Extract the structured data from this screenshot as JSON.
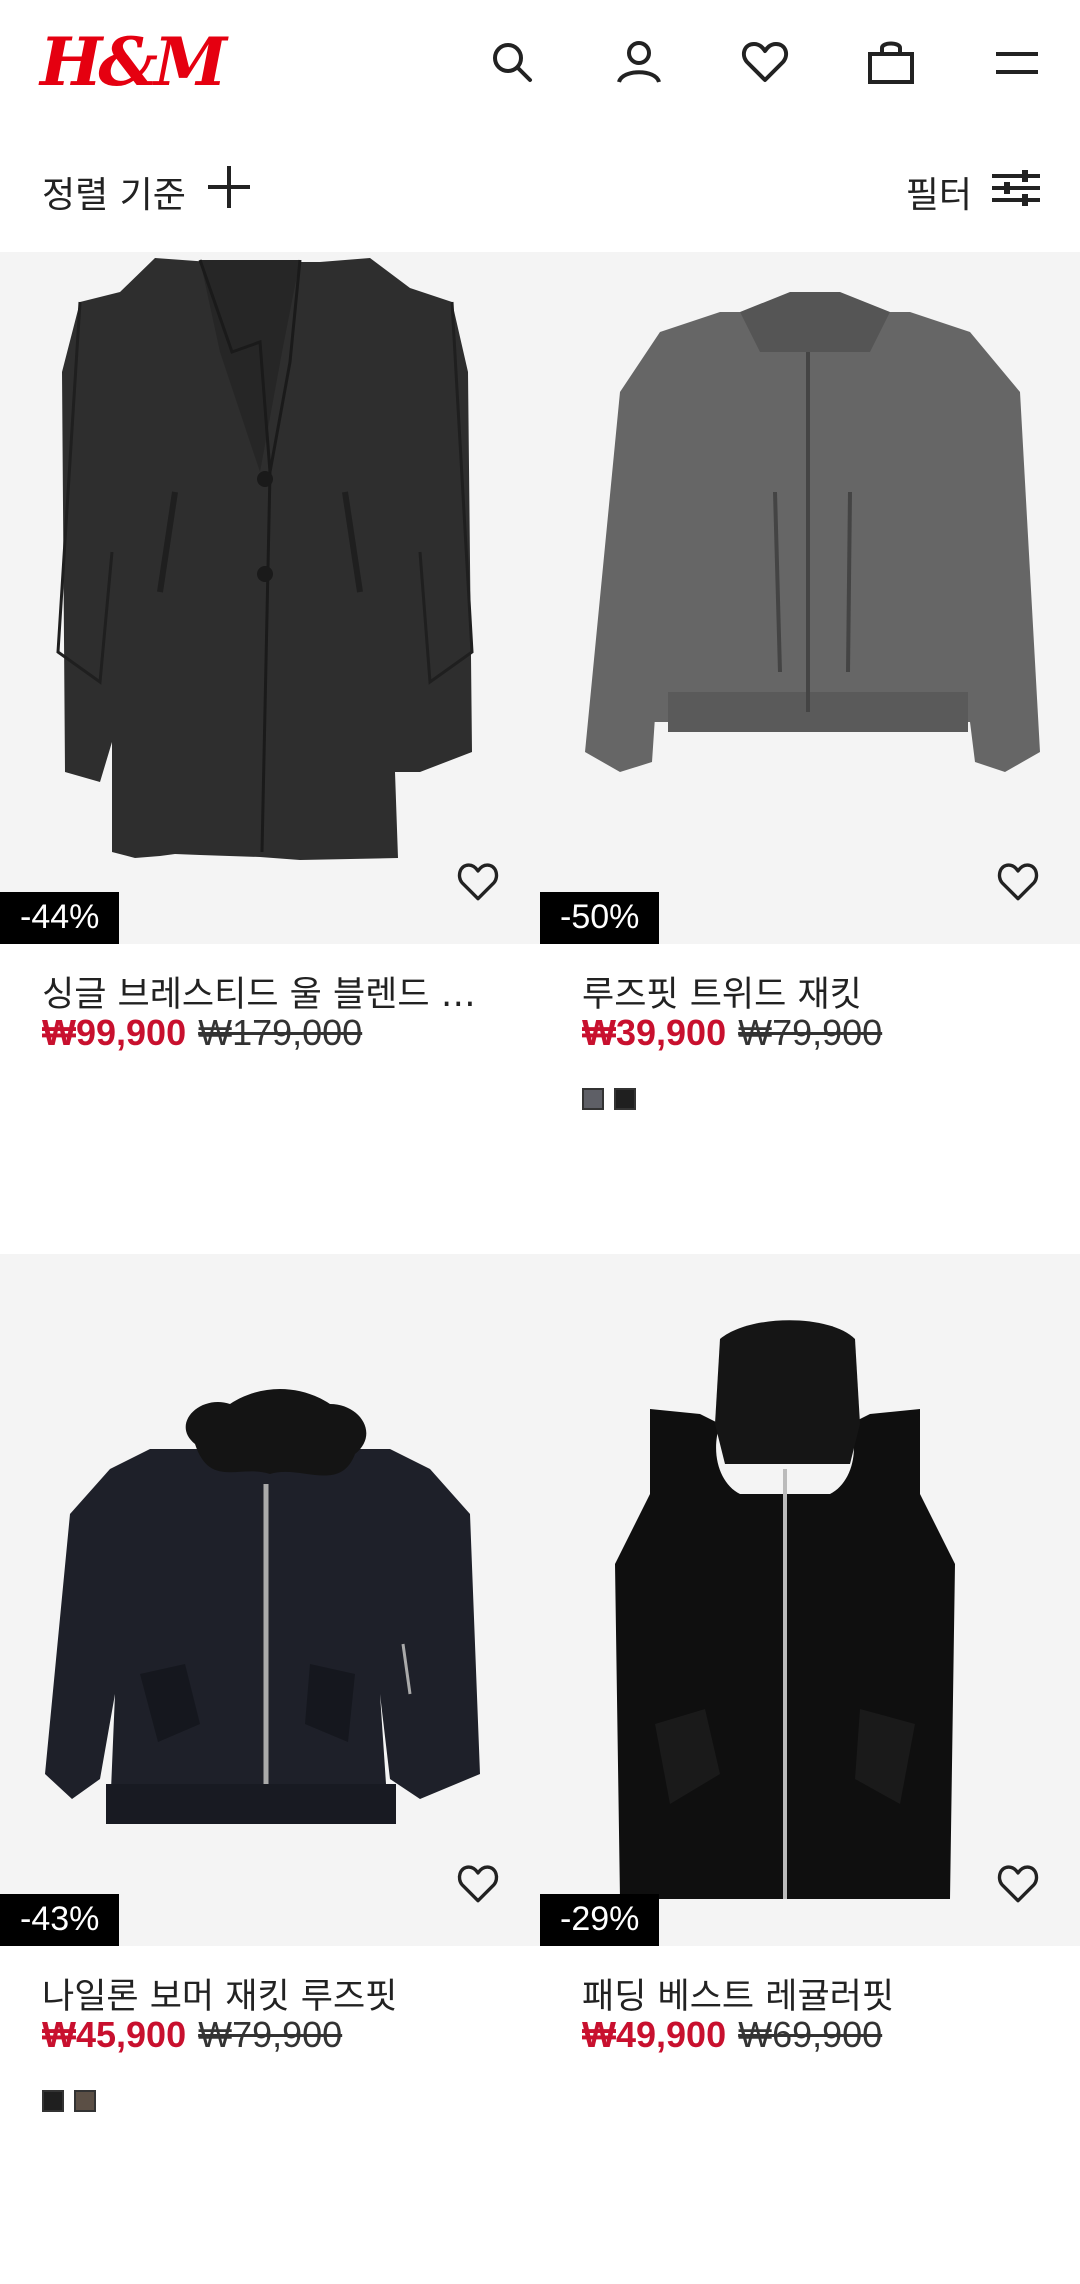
{
  "header": {
    "logo": "H&M",
    "icons": [
      "search-icon",
      "account-icon",
      "favorites-icon",
      "bag-icon",
      "menu-icon"
    ]
  },
  "toolbar": {
    "sort_label": "정렬 기준",
    "filter_label": "필터"
  },
  "products": [
    {
      "title": "싱글 브레스티드 울 블렌드 …",
      "sale_price": "₩99,900",
      "original_price": "₩179,000",
      "discount": "-44%",
      "swatches": []
    },
    {
      "title": "루즈핏 트위드 재킷",
      "sale_price": "₩39,900",
      "original_price": "₩79,900",
      "discount": "-50%",
      "swatches": [
        "#5e5f66",
        "#1f1f1f"
      ]
    },
    {
      "title": "나일론 보머 재킷 루즈핏",
      "sale_price": "₩45,900",
      "original_price": "₩79,900",
      "discount": "-43%",
      "swatches": [
        "#1f1f1f",
        "#5b4f45"
      ]
    },
    {
      "title": "패딩 베스트 레귤러핏",
      "sale_price": "₩49,900",
      "original_price": "₩69,900",
      "discount": "-29%",
      "swatches": []
    }
  ],
  "colors": {
    "brand": "#e50010",
    "sale": "#c8102e"
  }
}
